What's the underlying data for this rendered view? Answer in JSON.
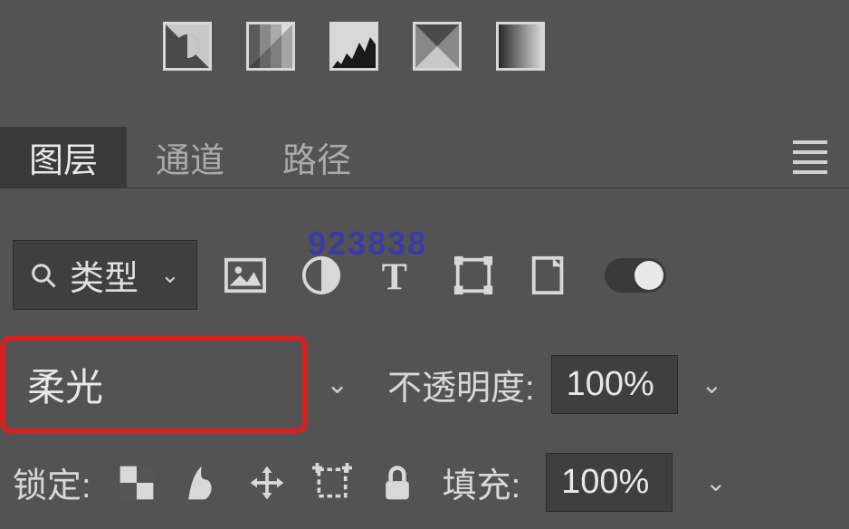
{
  "tabs": {
    "layers": "图层",
    "channels": "通道",
    "paths": "路径"
  },
  "watermark": "923838",
  "filter": {
    "type_label": "类型"
  },
  "blend": {
    "mode": "柔光",
    "opacity_label": "不透明度:",
    "opacity_value": "100%"
  },
  "lock": {
    "label": "锁定:",
    "fill_label": "填充:",
    "fill_value": "100%"
  }
}
